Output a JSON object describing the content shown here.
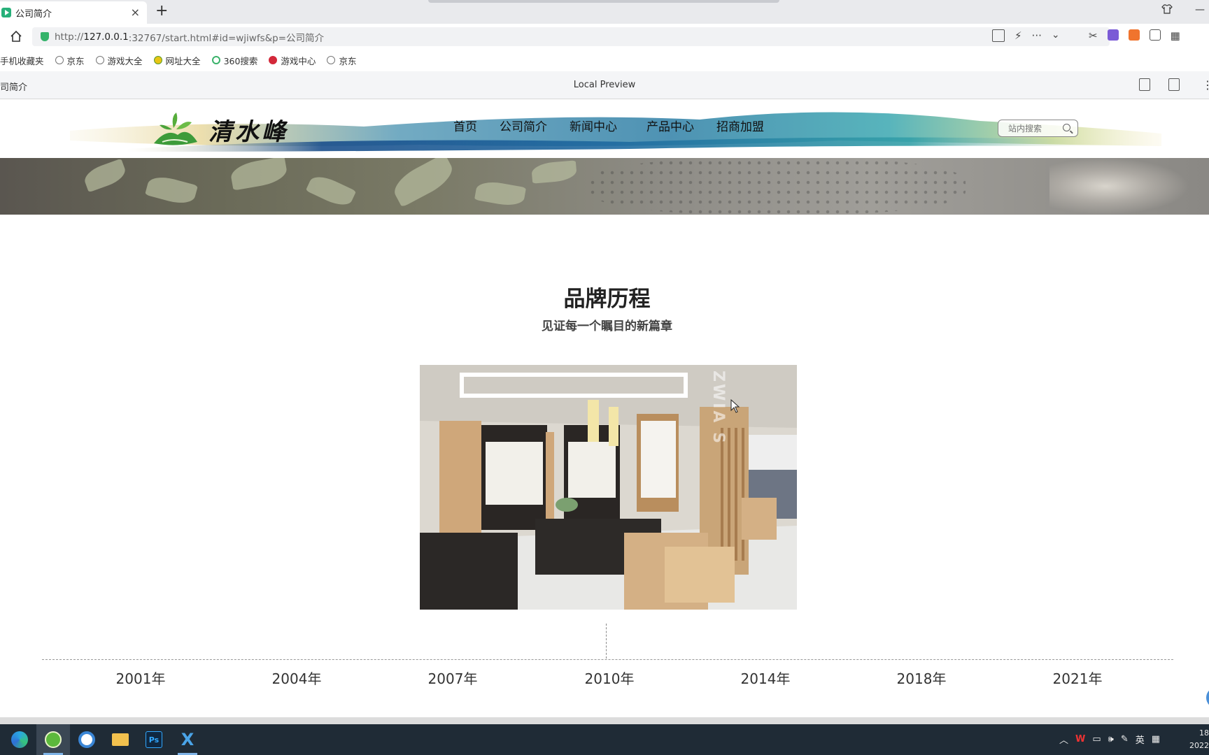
{
  "browser": {
    "tab_title": "公司简介",
    "tab_close": "×",
    "new_tab": "+",
    "url_prefix": "http://",
    "url_host": "127.0.0.1",
    "url_rest": ":32767/start.html#id=wjiwfs&p=公司简介",
    "minimize": "—",
    "bookmarks": [
      "手机收藏夹",
      "京东",
      "游戏大全",
      "网址大全",
      "360搜索",
      "游戏中心",
      "京东"
    ],
    "reader_left": "司简介",
    "reader_center": "Local Preview"
  },
  "site": {
    "logo_text": "清水峰",
    "nav": [
      "首页",
      "公司简介",
      "新闻中心",
      "产品中心",
      "招商加盟"
    ],
    "search_placeholder": "站内搜索"
  },
  "section": {
    "title": "品牌历程",
    "subtitle": "见证每一个瞩目的新篇章",
    "watermark": "ZWIA S"
  },
  "timeline": {
    "years": [
      "2001年",
      "2004年",
      "2007年",
      "2010年",
      "2014年",
      "2018年",
      "2021年"
    ]
  },
  "taskbar": {
    "ime": "英",
    "clock_line1": "18",
    "clock_line2": "2022"
  }
}
